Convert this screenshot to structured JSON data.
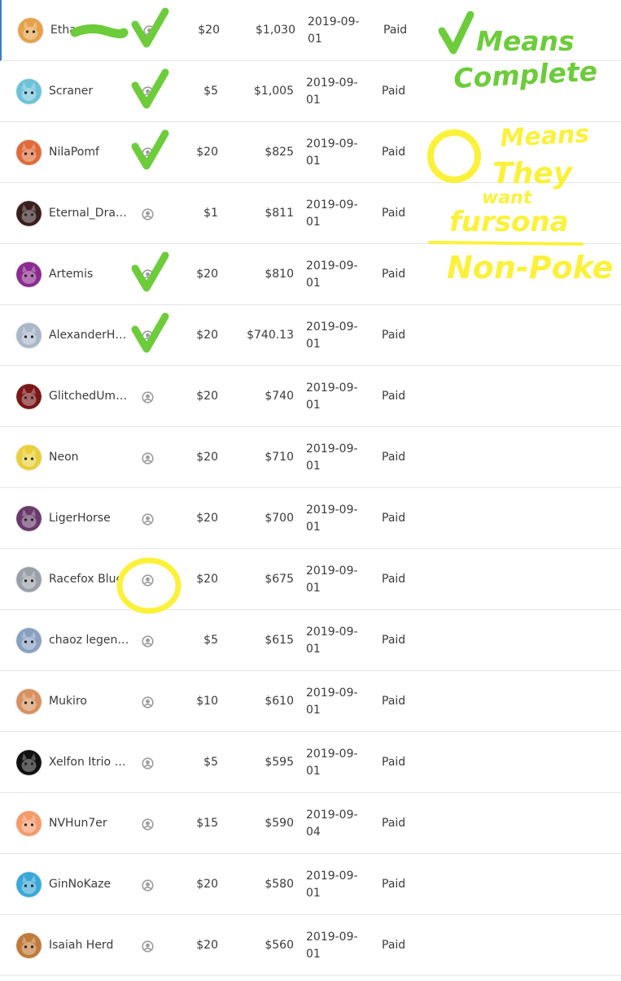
{
  "patrons": [
    {
      "name": "Ethan",
      "tier": "$20",
      "lifetime": "$1,030",
      "date": "2019-09-01",
      "status": "Paid",
      "avatar_icon": "fox-avatar-icon",
      "avatar_color": "#e5a24a",
      "marked_complete": true,
      "marked_fursona": false,
      "name_scribbled": true
    },
    {
      "name": "Scraner",
      "tier": "$5",
      "lifetime": "$1,005",
      "date": "2019-09-01",
      "status": "Paid",
      "avatar_icon": "scraner-avatar-icon",
      "avatar_color": "#6cc2d8",
      "marked_complete": true,
      "marked_fursona": false
    },
    {
      "name": "NilaPomf",
      "tier": "$20",
      "lifetime": "$825",
      "date": "2019-09-01",
      "status": "Paid",
      "avatar_icon": "fox-avatar-icon",
      "avatar_color": "#e06a3a",
      "marked_complete": true,
      "marked_fursona": false
    },
    {
      "name": "Eternal_Drag...",
      "tier": "$1",
      "lifetime": "$811",
      "date": "2019-09-01",
      "status": "Paid",
      "avatar_icon": "dragon-avatar-icon",
      "avatar_color": "#3a1f1f",
      "marked_complete": false,
      "marked_fursona": false
    },
    {
      "name": "Artemis",
      "tier": "$20",
      "lifetime": "$810",
      "date": "2019-09-01",
      "status": "Paid",
      "avatar_icon": "artemis-avatar-icon",
      "avatar_color": "#8a2b8f",
      "marked_complete": true,
      "marked_fursona": false
    },
    {
      "name": "AlexanderHe...",
      "tier": "$20",
      "lifetime": "$740.13",
      "date": "2019-09-01",
      "status": "Paid",
      "avatar_icon": "wolf-avatar-icon",
      "avatar_color": "#aab7c8",
      "marked_complete": true,
      "marked_fursona": false
    },
    {
      "name": "GlitchedUmbre",
      "tier": "$20",
      "lifetime": "$740",
      "date": "2019-09-01",
      "status": "Paid",
      "avatar_icon": "umbreon-avatar-icon",
      "avatar_color": "#7a1717",
      "marked_complete": false,
      "marked_fursona": false
    },
    {
      "name": "Neon",
      "tier": "$20",
      "lifetime": "$710",
      "date": "2019-09-01",
      "status": "Paid",
      "avatar_icon": "pikachu-avatar-icon",
      "avatar_color": "#e8cf3a",
      "marked_complete": false,
      "marked_fursona": false
    },
    {
      "name": "LigerHorse",
      "tier": "$20",
      "lifetime": "$700",
      "date": "2019-09-01",
      "status": "Paid",
      "avatar_icon": "spiral-avatar-icon",
      "avatar_color": "#6a3a6a",
      "marked_complete": false,
      "marked_fursona": false
    },
    {
      "name": "Racefox Blue",
      "tier": "$20",
      "lifetime": "$675",
      "date": "2019-09-01",
      "status": "Paid",
      "avatar_icon": "racefox-avatar-icon",
      "avatar_color": "#9aa0a8",
      "marked_complete": false,
      "marked_fursona": true
    },
    {
      "name": "chaoz legends",
      "tier": "$5",
      "lifetime": "$615",
      "date": "2019-09-01",
      "status": "Paid",
      "avatar_icon": "cat-avatar-icon",
      "avatar_color": "#8aa0c0",
      "marked_complete": false,
      "marked_fursona": false
    },
    {
      "name": "Mukiro",
      "tier": "$10",
      "lifetime": "$610",
      "date": "2019-09-01",
      "status": "Paid",
      "avatar_icon": "mukiro-avatar-icon",
      "avatar_color": "#d89060",
      "marked_complete": false,
      "marked_fursona": false
    },
    {
      "name": "Xelfon Itrio K...",
      "tier": "$5",
      "lifetime": "$595",
      "date": "2019-09-01",
      "status": "Paid",
      "avatar_icon": "xelfon-avatar-icon",
      "avatar_color": "#111111",
      "marked_complete": false,
      "marked_fursona": false
    },
    {
      "name": "NVHun7er",
      "tier": "$15",
      "lifetime": "$590",
      "date": "2019-09-04",
      "status": "Paid",
      "avatar_icon": "hamster-avatar-icon",
      "avatar_color": "#f59a6a",
      "marked_complete": false,
      "marked_fursona": false
    },
    {
      "name": "GinNoKaze",
      "tier": "$20",
      "lifetime": "$580",
      "date": "2019-09-01",
      "status": "Paid",
      "avatar_icon": "ginnokaze-avatar-icon",
      "avatar_color": "#3aa8d8",
      "marked_complete": false,
      "marked_fursona": false
    },
    {
      "name": "Isaiah Herd",
      "tier": "$20",
      "lifetime": "$560",
      "date": "2019-09-01",
      "status": "Paid",
      "avatar_icon": "isaiah-avatar-icon",
      "avatar_color": "#c07a3a",
      "marked_complete": false,
      "marked_fursona": false
    }
  ],
  "legend": {
    "complete_note": [
      "Means",
      "Complete"
    ],
    "fursona_note": [
      "Means",
      "They",
      "want",
      "fursona",
      "Non-Poke"
    ],
    "complete_color": "#6ccc3a",
    "fursona_color": "#fbf13a"
  }
}
